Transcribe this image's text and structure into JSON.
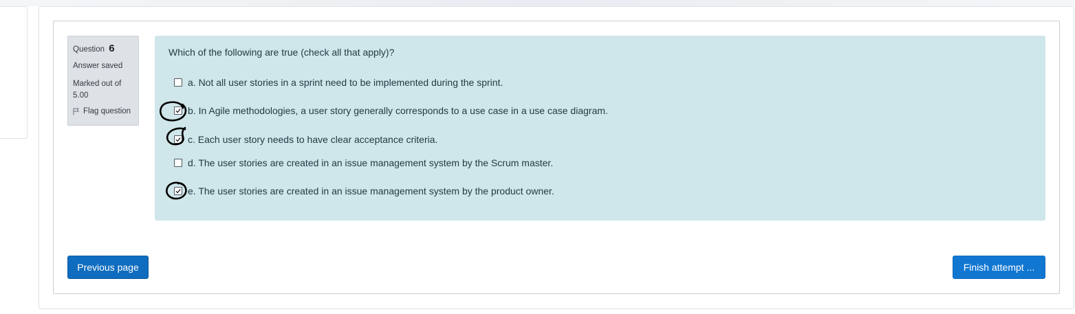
{
  "question": {
    "label": "Question",
    "number": "6",
    "status": "Answer saved",
    "marked_out_of": "Marked out of",
    "max_mark": "5.00",
    "flag_label": "Flag question",
    "text": "Which of the following are true (check all that apply)?"
  },
  "options": [
    {
      "text": "a. Not all user stories in a sprint need to be implemented during the sprint.",
      "checked": false
    },
    {
      "text": "b. In Agile methodologies, a user story generally corresponds to a use case in a use case diagram.",
      "checked": true
    },
    {
      "text": "c. Each user story needs to have clear acceptance criteria.",
      "checked": true
    },
    {
      "text": "d. The user stories are created in an issue management system by the Scrum master.",
      "checked": false
    },
    {
      "text": "e. The user stories are created in an issue management system by the product owner.",
      "checked": true
    }
  ],
  "navigation": {
    "previous_label": "Previous page",
    "finish_label": "Finish attempt ..."
  },
  "colors": {
    "primary": "#0f6cbf",
    "content_bg": "#cfe6ea",
    "info_bg": "#dee2e6"
  }
}
